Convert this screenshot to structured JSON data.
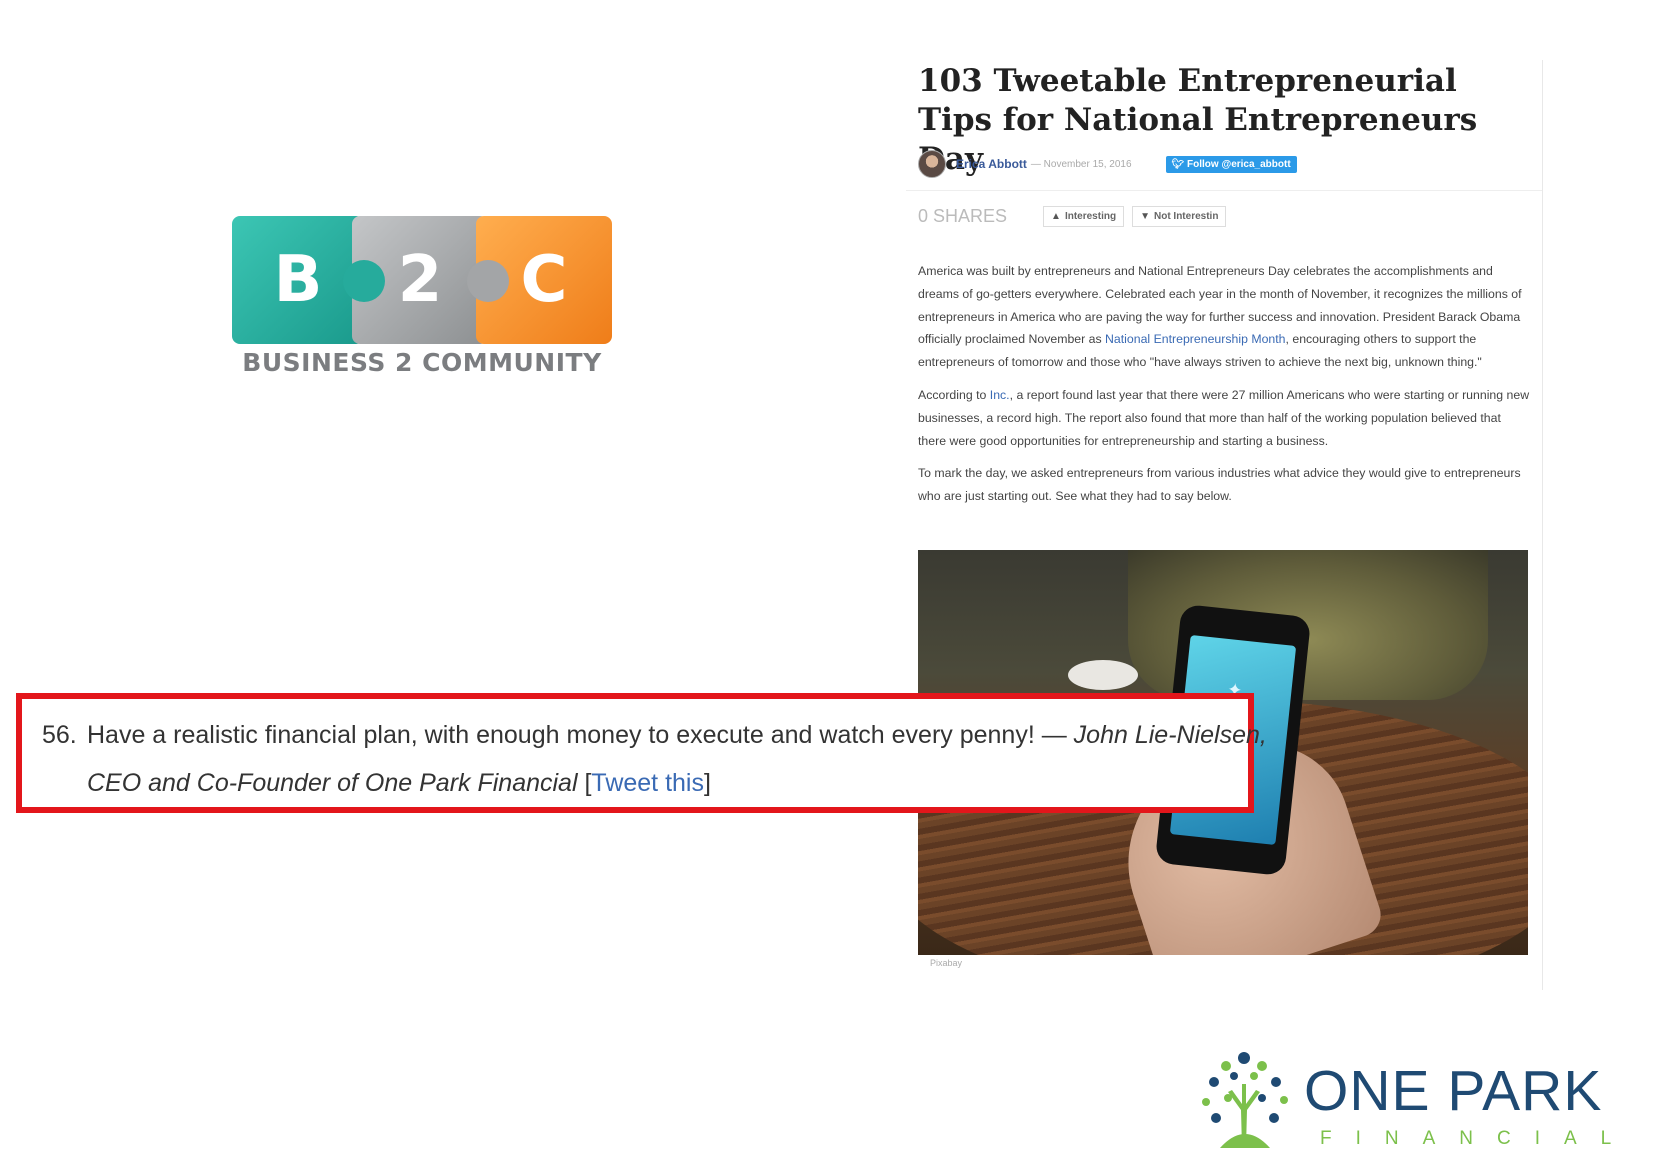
{
  "b2c_logo": {
    "letters": [
      "B",
      "2",
      "C"
    ],
    "tagline": "BUSINESS 2 COMMUNITY",
    "colors": {
      "teal": "#2bb3a3",
      "gray": "#a3a5a7",
      "orange": "#f6912f"
    }
  },
  "article": {
    "title": "103 Tweetable Entrepreneurial Tips for National Entrepreneurs Day",
    "author": "Erica Abbott",
    "date": "— November 15, 2016",
    "follow_label": "Follow @erica_abbott",
    "shares": "0 SHARES",
    "vote_interesting": "Interesting",
    "vote_not_interesting": "Not Interestin",
    "paragraphs": [
      {
        "a": "America was built by entrepreneurs and National Entrepreneurs Day celebrates the accomplishments and dreams of go-getters everywhere. Celebrated each year in the month of November, it recognizes the millions of entrepreneurs in America who are paving the way for further success and innovation. President Barack Obama officially proclaimed November as ",
        "link": "National Entrepreneurship Month",
        "b": ", encouraging others to support the entrepreneurs of tomorrow and those who \"have always striven to achieve the next big, unknown thing.\""
      },
      {
        "a": "According to ",
        "link": "Inc.",
        "b": ", a report found last year that there were 27 million Americans who were starting or running new businesses, a record high. The report also found that more than half of the working population believed that there were good opportunities for entrepreneurship and starting a business."
      },
      {
        "a": "To mark the day, we asked entrepreneurs from various industries what advice they would give to entrepreneurs who are just starting out. See what they had to say below.",
        "link": "",
        "b": ""
      }
    ],
    "image_caption": "Pixabay"
  },
  "quote": {
    "number": "56.",
    "text": "Have a realistic financial plan, with enough money to execute and watch every penny! — ",
    "author": "John Lie-Nielsen, CEO and Co-Founder of One Park Financial",
    "open_bracket": " [",
    "link": "Tweet this",
    "close_bracket": "]",
    "border_color": "#e3161b"
  },
  "opf_logo": {
    "name": "ONE PARK",
    "sub": "FINANCIAL",
    "colors": {
      "navy": "#1f4a73",
      "green": "#7cc04b"
    }
  }
}
